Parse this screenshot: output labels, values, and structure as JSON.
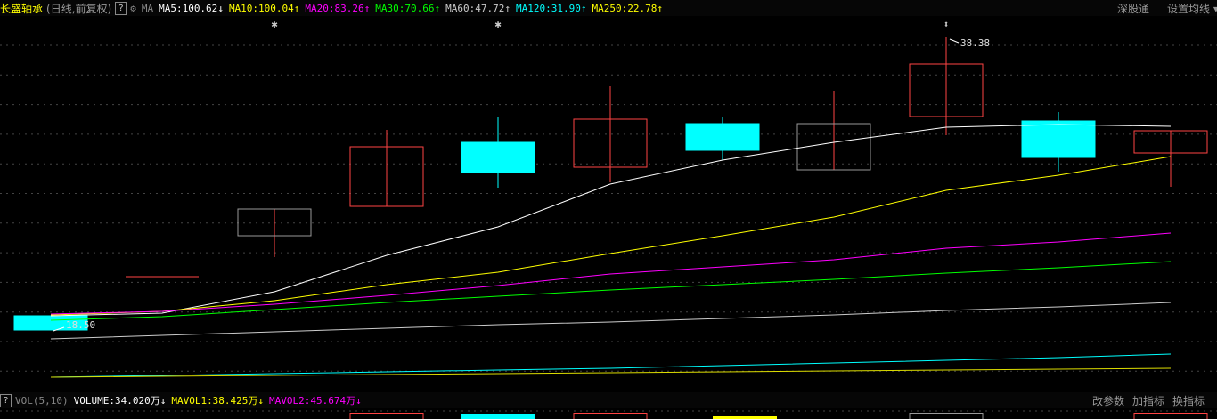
{
  "header": {
    "title": "长盛轴承",
    "mode": "(日线,前复权)",
    "help": "?",
    "indicator": "MA",
    "ma": [
      {
        "label": "MA5:100.62",
        "arrow": "↓",
        "color": "#ffffff"
      },
      {
        "label": "MA10:100.04",
        "arrow": "↑",
        "color": "#ffff00"
      },
      {
        "label": "MA20:83.26",
        "arrow": "↑",
        "color": "#ff00ff"
      },
      {
        "label": "MA30:70.66",
        "arrow": "↑",
        "color": "#00ff00"
      },
      {
        "label": "MA60:47.72",
        "arrow": "↑",
        "color": "#cccccc"
      },
      {
        "label": "MA120:31.90",
        "arrow": "↑",
        "color": "#00ffff"
      },
      {
        "label": "MA250:22.78",
        "arrow": "↑",
        "color": "#ffff00"
      }
    ],
    "right": [
      "深股通",
      "设置均线 ▾"
    ]
  },
  "chart": {
    "high_label": "38.38",
    "low_label": "18.50"
  },
  "volume": {
    "help": "?",
    "indicator": "VOL(5,10)",
    "volume": "VOLUME:34.020万",
    "volume_arrow": "↓",
    "mavol1": "MAVOL1:38.425万",
    "mavol1_arrow": "↓",
    "mavol2": "MAVOL2:45.674万",
    "mavol2_arrow": "↓",
    "right": [
      "改参数",
      "加指标",
      "换指标"
    ]
  },
  "colors": {
    "up": "#ff4444",
    "down": "#00ffff",
    "bg": "#000000"
  }
}
